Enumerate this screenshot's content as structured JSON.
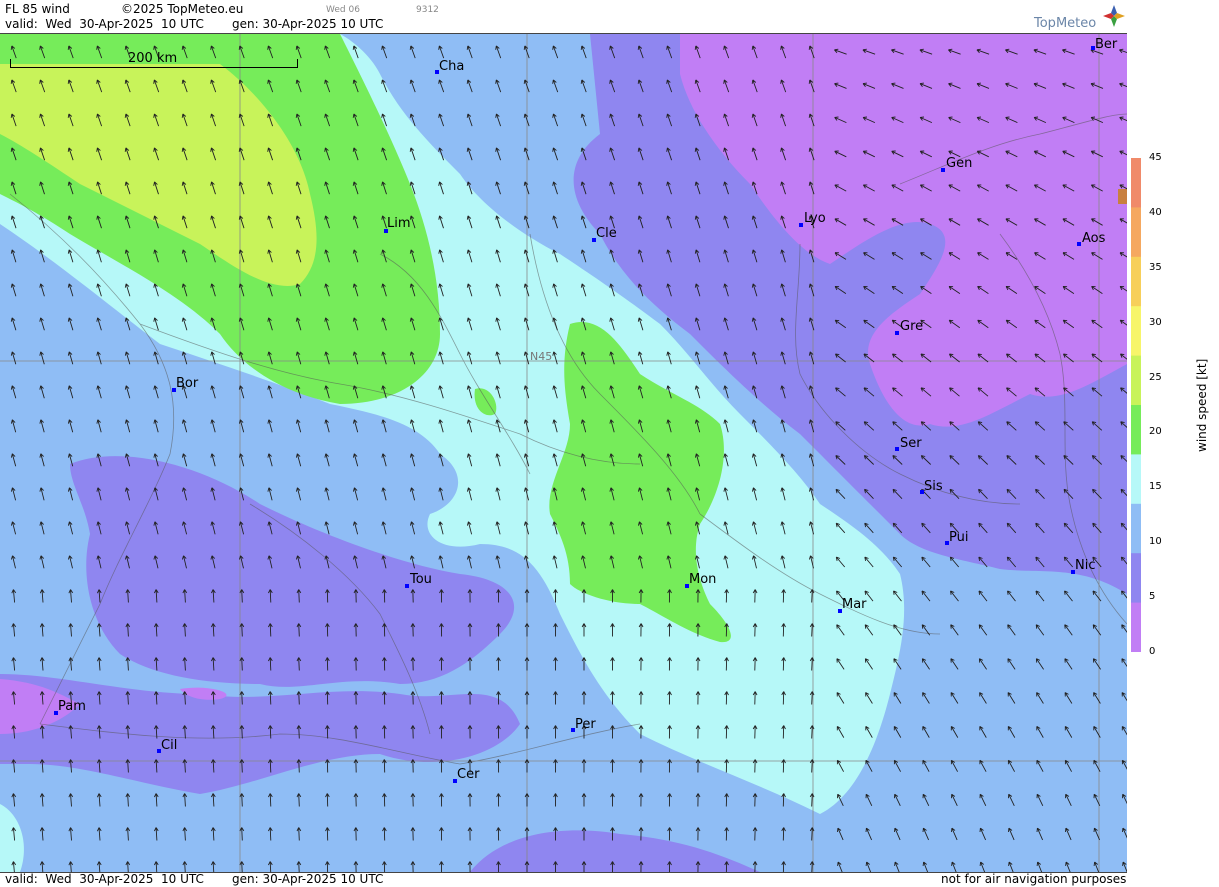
{
  "header": {
    "title": "FL 85 wind",
    "copyright": "©2025 TopMeteo.eu",
    "day_code": "Wed 06",
    "code": "9312",
    "valid": "valid:  Wed  30-Apr-2025  10 UTC",
    "gen": "gen: 30-Apr-2025 10 UTC",
    "logo_text": "TopMeteo"
  },
  "footer": {
    "valid": "valid:  Wed  30-Apr-2025  10 UTC",
    "gen": "gen: 30-Apr-2025 10 UTC",
    "disclaimer": "not for air navigation purposes"
  },
  "scale_bar": {
    "label": "200 km"
  },
  "grid_label": "N45",
  "cities": [
    {
      "name": "Ber"
    },
    {
      "name": "Cha"
    },
    {
      "name": "Gen"
    },
    {
      "name": "Lim"
    },
    {
      "name": "Cle"
    },
    {
      "name": "Lyo"
    },
    {
      "name": "Aos"
    },
    {
      "name": "Gre"
    },
    {
      "name": "Bor"
    },
    {
      "name": "Ser"
    },
    {
      "name": "Sis"
    },
    {
      "name": "Pui"
    },
    {
      "name": "Tou"
    },
    {
      "name": "Mon"
    },
    {
      "name": "Nic"
    },
    {
      "name": "Mar"
    },
    {
      "name": "Pam"
    },
    {
      "name": "Per"
    },
    {
      "name": "Cil"
    },
    {
      "name": "Cer"
    }
  ],
  "legend": {
    "title": "wind  speed  [kt]",
    "ticks": [
      "45",
      "40",
      "35",
      "30",
      "25",
      "20",
      "15",
      "10",
      "5",
      "0"
    ],
    "colors": [
      "#f08a6a",
      "#f5a860",
      "#f7cf5a",
      "#f7f56a",
      "#c8f35a",
      "#76ec5a",
      "#b6f8f8",
      "#8fbdf5",
      "#8f86f0",
      "#c17ef5"
    ]
  },
  "colors": {
    "light_violet": "#c17ef5",
    "violet": "#8f86f0",
    "blue": "#8fbdf5",
    "cyan": "#b6f8f8",
    "green": "#76ec5a",
    "yellow_green": "#c8f35a"
  }
}
